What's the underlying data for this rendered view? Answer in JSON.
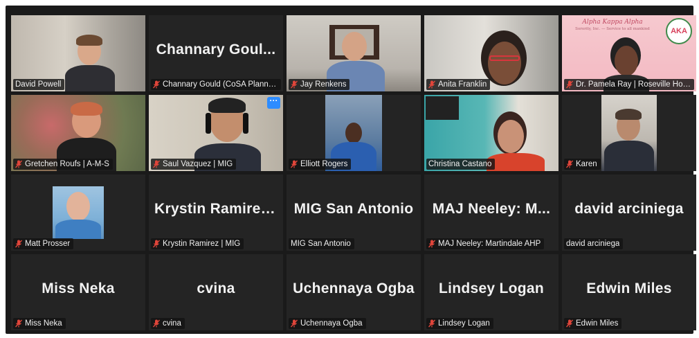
{
  "participants": [
    {
      "name": "David Powell",
      "display": "",
      "muted": false,
      "video": true
    },
    {
      "name": "Channary Gould (CoSA Plannin...",
      "display": "Channary  Goul...",
      "muted": true,
      "video": false
    },
    {
      "name": "Jay Renkens",
      "display": "",
      "muted": true,
      "video": true
    },
    {
      "name": "Anita Franklin",
      "display": "",
      "muted": true,
      "video": true
    },
    {
      "name": "Dr. Pamela Ray | Roseville Hous...",
      "display": "",
      "muted": true,
      "video": true
    },
    {
      "name": "Gretchen Roufs | A-M-S",
      "display": "",
      "muted": true,
      "video": true
    },
    {
      "name": "Saul Vazquez | MIG",
      "display": "",
      "muted": true,
      "video": true
    },
    {
      "name": "Elliott Rogers",
      "display": "",
      "muted": true,
      "video": true
    },
    {
      "name": "Christina Castano",
      "display": "",
      "muted": false,
      "video": true
    },
    {
      "name": "Karen",
      "display": "",
      "muted": true,
      "video": true
    },
    {
      "name": "Matt Prosser",
      "display": "",
      "muted": true,
      "video": true
    },
    {
      "name": "Krystin Ramirez | MIG",
      "display": "Krystin  Ramirez...",
      "muted": true,
      "video": false
    },
    {
      "name": "MIG San Antonio",
      "display": "MIG San Antonio",
      "muted": false,
      "video": false
    },
    {
      "name": "MAJ Neeley: Martindale AHP",
      "display": "MAJ  Neeley:  M...",
      "muted": true,
      "video": false
    },
    {
      "name": "david arciniega",
      "display": "david arciniega",
      "muted": false,
      "video": false
    },
    {
      "name": "Miss Neka",
      "display": "Miss Neka",
      "muted": true,
      "video": false
    },
    {
      "name": "cvina",
      "display": "cvina",
      "muted": true,
      "video": false
    },
    {
      "name": "Uchennaya Ogba",
      "display": "Uchennaya Ogba",
      "muted": true,
      "video": false
    },
    {
      "name": "Lindsey Logan",
      "display": "Lindsey Logan",
      "muted": true,
      "video": false
    },
    {
      "name": "Edwin Miles",
      "display": "Edwin Miles",
      "muted": true,
      "video": false
    }
  ],
  "pamela_banner": {
    "title": "Alpha Kappa Alpha",
    "subtitle": "Sorority, Inc. — Service to all mankind",
    "logo_text": "AKA"
  },
  "more_button": "···",
  "colors": {
    "active_speaker": "#c5e35a",
    "mute_icon": "#e0453a",
    "tile_bg": "#242424",
    "more_button": "#2d8cff"
  }
}
